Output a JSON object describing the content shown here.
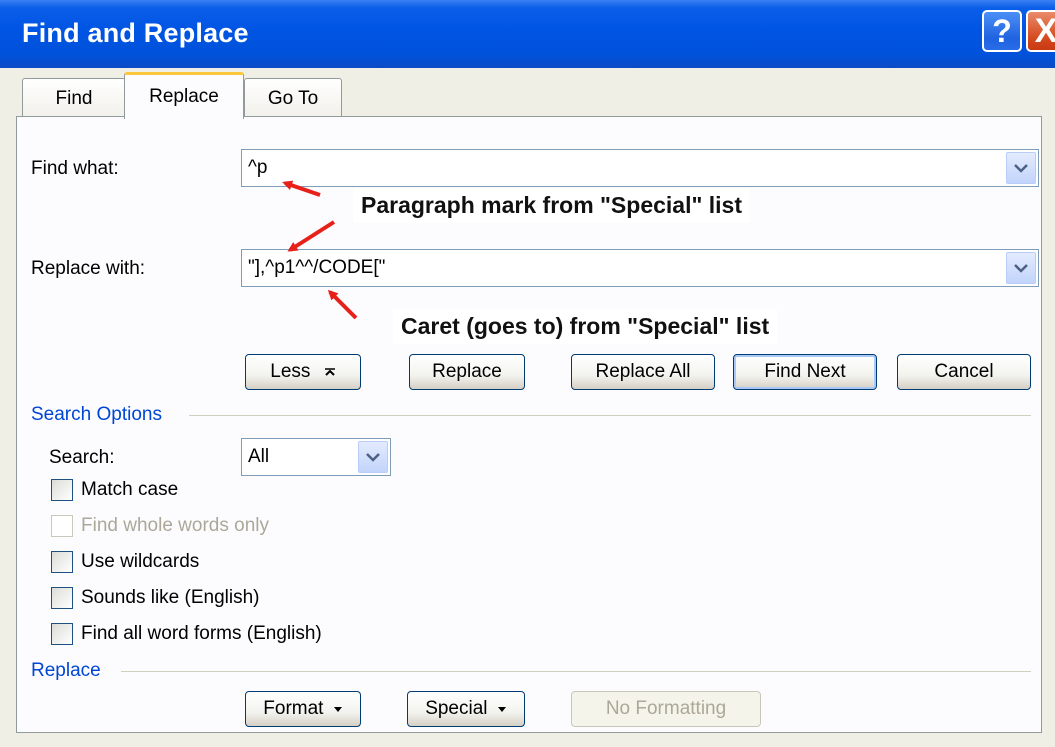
{
  "window": {
    "title": "Find and Replace",
    "help_label": "?",
    "close_label": "X"
  },
  "tabs": [
    {
      "label": "Find",
      "active": false
    },
    {
      "label": "Replace",
      "active": true
    },
    {
      "label": "Go To",
      "active": false
    }
  ],
  "find": {
    "label": "Find what:",
    "value": "^p"
  },
  "replace": {
    "label": "Replace with:",
    "value": "\"],^p1^^/CODE[\""
  },
  "annotations": {
    "paragraph": "Paragraph mark from \"Special\" list",
    "caret": "Caret (goes to) from \"Special\" list"
  },
  "buttons": {
    "less": "Less",
    "replace": "Replace",
    "replace_all": "Replace All",
    "find_next": "Find Next",
    "cancel": "Cancel"
  },
  "search_options": {
    "heading": "Search Options",
    "search_label": "Search:",
    "search_value": "All",
    "checkboxes": [
      {
        "label": "Match case",
        "checked": false,
        "enabled": true
      },
      {
        "label": "Find whole words only",
        "checked": false,
        "enabled": false
      },
      {
        "label": "Use wildcards",
        "checked": false,
        "enabled": true
      },
      {
        "label": "Sounds like (English)",
        "checked": false,
        "enabled": true
      },
      {
        "label": "Find all word forms (English)",
        "checked": false,
        "enabled": true
      }
    ]
  },
  "replace_section": {
    "heading": "Replace",
    "format_label": "Format",
    "special_label": "Special",
    "no_formatting_label": "No Formatting"
  },
  "colors": {
    "titlebar": "#0054E3",
    "section_heading": "#0046D5",
    "annotation_arrow": "#E8201A",
    "active_tab_accent": "#FFC73C"
  }
}
